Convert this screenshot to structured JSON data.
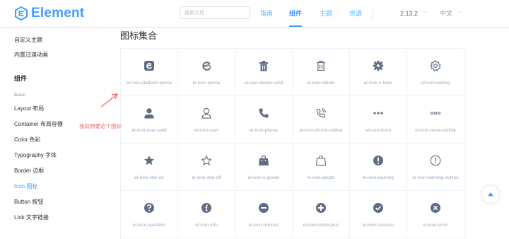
{
  "header": {
    "logo_text": "Element",
    "search_placeholder": "搜索文档",
    "nav": [
      "指南",
      "组件",
      "主题",
      "资源"
    ],
    "version": "2.13.2",
    "language": "中文"
  },
  "sidebar": {
    "items": [
      {
        "label": "自定义主题",
        "kind": "item"
      },
      {
        "label": "内置过渡动画",
        "kind": "item"
      },
      {
        "label": "组件",
        "kind": "group"
      },
      {
        "label": "Basic",
        "kind": "caption"
      },
      {
        "label": "Layout 布局",
        "kind": "item"
      },
      {
        "label": "Container 布局容器",
        "kind": "item"
      },
      {
        "label": "Color 色彩",
        "kind": "item"
      },
      {
        "label": "Typography 字体",
        "kind": "item"
      },
      {
        "label": "Border 边框",
        "kind": "item"
      },
      {
        "label": "Icon 图标",
        "kind": "current"
      },
      {
        "label": "Button 按钮",
        "kind": "item"
      },
      {
        "label": "Link 文字链接",
        "kind": "item"
      }
    ]
  },
  "main": {
    "title": "图标集合",
    "icons": [
      {
        "name": "el-icon-platform-eleme",
        "icon": "platform-eleme-icon"
      },
      {
        "name": "el-icon-eleme",
        "icon": "eleme-icon"
      },
      {
        "name": "el-icon-delete-solid",
        "icon": "delete-solid-icon"
      },
      {
        "name": "el-icon-delete",
        "icon": "delete-icon"
      },
      {
        "name": "el-icon-s-tools",
        "icon": "s-tools-icon"
      },
      {
        "name": "el-icon-setting",
        "icon": "setting-icon"
      },
      {
        "name": "el-icon-user-solid",
        "icon": "user-solid-icon"
      },
      {
        "name": "el-icon-user",
        "icon": "user-icon"
      },
      {
        "name": "el-icon-phone",
        "icon": "phone-icon"
      },
      {
        "name": "el-icon-phone-outline",
        "icon": "phone-outline-icon"
      },
      {
        "name": "el-icon-more",
        "icon": "more-icon"
      },
      {
        "name": "el-icon-more-outline",
        "icon": "more-outline-icon"
      },
      {
        "name": "el-icon-star-on",
        "icon": "star-on-icon"
      },
      {
        "name": "el-icon-star-off",
        "icon": "star-off-icon"
      },
      {
        "name": "el-icon-s-goods",
        "icon": "s-goods-icon"
      },
      {
        "name": "el-icon-goods",
        "icon": "goods-icon"
      },
      {
        "name": "el-icon-warning",
        "icon": "warning-icon"
      },
      {
        "name": "el-icon-warning-outline",
        "icon": "warning-outline-icon"
      },
      {
        "name": "el-icon-question",
        "icon": "question-icon"
      },
      {
        "name": "el-icon-info",
        "icon": "info-icon"
      },
      {
        "name": "el-icon-remove",
        "icon": "remove-icon"
      },
      {
        "name": "el-icon-circle-plus",
        "icon": "circle-plus-icon"
      },
      {
        "name": "el-icon-success",
        "icon": "success-icon"
      },
      {
        "name": "el-icon-error",
        "icon": "error-icon"
      }
    ]
  },
  "annotation": {
    "text": "我就想要这个图标"
  },
  "colors": {
    "accent": "#409eff",
    "icon": "#5e6d82",
    "annotation": "#f56c6c"
  }
}
